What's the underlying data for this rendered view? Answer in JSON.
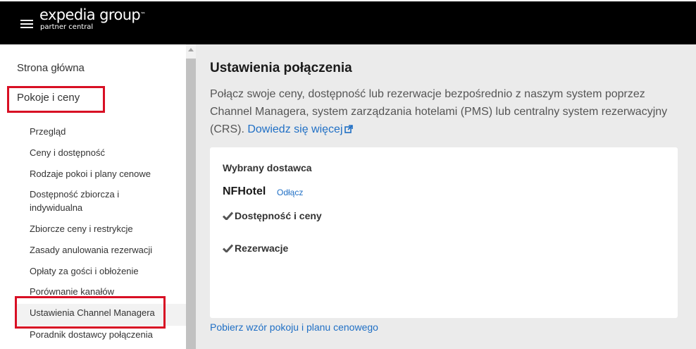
{
  "header": {
    "logo_text": "expedia group",
    "logo_tm": "™",
    "logo_subtitle": "partner central",
    "menu_icon": "hamburger-menu-icon"
  },
  "sidebar": {
    "top_items": [
      {
        "label": "Strona główna"
      },
      {
        "label": "Pokoje i ceny",
        "highlighted": true
      }
    ],
    "sub_items": [
      {
        "label": "Przegląd"
      },
      {
        "label": "Ceny i dostępność"
      },
      {
        "label": "Rodzaje pokoi i plany cenowe"
      },
      {
        "label": "Dostępność zbiorcza i indywidualna"
      },
      {
        "label": "Zbiorcze ceny i restrykcje"
      },
      {
        "label": "Zasady anulowania rezerwacji"
      },
      {
        "label": "Opłaty za gości i obłożenie"
      },
      {
        "label": "Porównanie kanałów"
      },
      {
        "label": "Ustawienia Channel Managera",
        "active": true,
        "highlighted": true
      },
      {
        "label": "Poradnik dostawcy połączenia"
      }
    ],
    "highlight_color": "#d80f24"
  },
  "main": {
    "title": "Ustawienia połączenia",
    "description": "Połącz swoje ceny, dostępność lub rezerwacje bezpośrednio z naszym system poprzez Channel Managera, system zarządzania hotelami (PMS) lub centralny system rezerwacyjny (CRS).",
    "learn_more": "Dowiedz się więcej",
    "learn_more_icon": "external-link-icon",
    "card": {
      "heading": "Wybrany dostawca",
      "provider": "NFHotel",
      "disconnect": "Odłącz",
      "features": [
        {
          "label": "Dostępność i ceny",
          "icon": "checkmark-icon"
        },
        {
          "label": "Rezerwacje",
          "icon": "checkmark-icon"
        }
      ]
    },
    "download_link": "Pobierz wzór pokoju i planu cenowego",
    "link_color": "#1f6fc5"
  }
}
